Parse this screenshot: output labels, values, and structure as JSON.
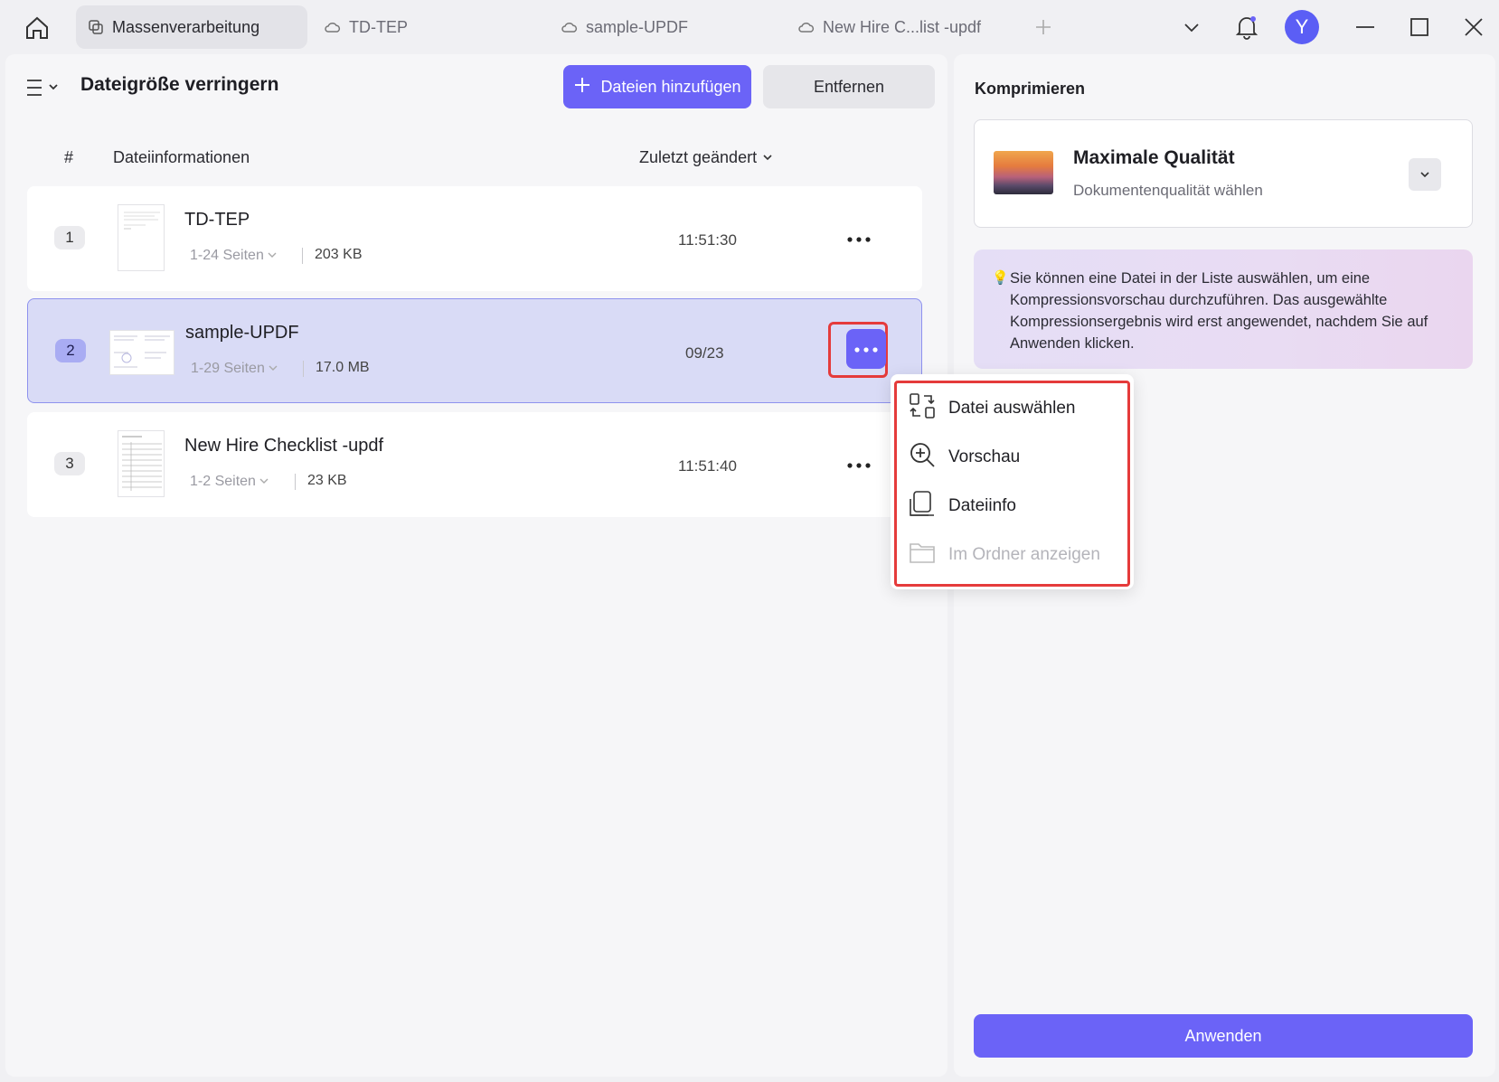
{
  "tabs": [
    {
      "label": "Massenverarbeitung",
      "icon": "stack-icon",
      "active": true
    },
    {
      "label": "TD-TEP",
      "icon": "cloud-icon"
    },
    {
      "label": "sample-UPDF",
      "icon": "cloud-icon"
    },
    {
      "label": "New Hire C...list -updf",
      "icon": "cloud-icon"
    }
  ],
  "user": {
    "avatar_letter": "Y"
  },
  "left": {
    "title": "Dateigröße verringern",
    "add_label": "Dateien hinzufügen",
    "remove_label": "Entfernen",
    "col_num": "#",
    "col_info": "Dateiinformationen",
    "col_modified": "Zuletzt geändert"
  },
  "files": [
    {
      "num": "1",
      "name": "TD-TEP",
      "pages": "1-24 Seiten",
      "size": "203 KB",
      "modified": "11:51:30"
    },
    {
      "num": "2",
      "name": "sample-UPDF",
      "pages": "1-29 Seiten",
      "size": "17.0 MB",
      "modified": "09/23"
    },
    {
      "num": "3",
      "name": "New Hire Checklist -updf",
      "pages": "1-2 Seiten",
      "size": "23 KB",
      "modified": "11:51:40"
    }
  ],
  "context_menu": [
    {
      "label": "Datei auswählen",
      "icon": "switch-file-icon"
    },
    {
      "label": "Vorschau",
      "icon": "zoom-in-icon"
    },
    {
      "label": "Dateiinfo",
      "icon": "file-info-icon"
    },
    {
      "label": "Im Ordner anzeigen",
      "icon": "folder-icon",
      "disabled": true
    }
  ],
  "right": {
    "title": "Komprimieren",
    "quality_title": "Maximale Qualität",
    "quality_sub": "Dokumentenqualität wählen",
    "info_text": "Sie können eine Datei in der Liste auswählen, um eine Kompressionsvorschau durchzuführen. Das ausgewählte Kompressionsergebnis wird erst angewendet, nachdem Sie auf Anwenden klicken.",
    "apply_label": "Anwenden"
  },
  "colors": {
    "accent": "#6b63f7",
    "highlight": "#e53b3b",
    "selected_row": "#d9dbf6"
  }
}
